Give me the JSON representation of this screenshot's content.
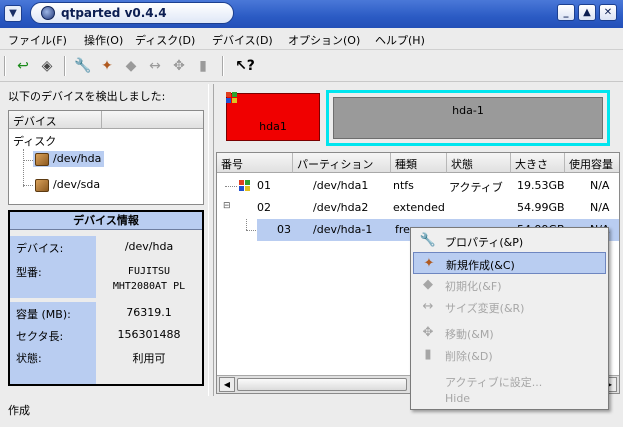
{
  "window": {
    "title": "qtparted v0.4.4"
  },
  "menu": [
    "ファイル(F)",
    "操作(O)",
    "ディスク(D)",
    "デバイス(D)",
    "オプション(O)",
    "ヘルプ(H)"
  ],
  "left": {
    "caption": "以下のデバイスを検出しました:",
    "tree_header": "デバイス",
    "tree_root": "ディスク",
    "devices": [
      "/dev/hda",
      "/dev/sda"
    ]
  },
  "info": {
    "title": "デバイス情報",
    "rows": [
      {
        "label": "デバイス:",
        "value": "/dev/hda"
      },
      {
        "label": "型番:",
        "value": "FUJITSU MHT2080AT PL"
      },
      {
        "label": "容量 (MB):",
        "value": "76319.1"
      },
      {
        "label": "セクタ長:",
        "value": "156301488"
      },
      {
        "label": "状態:",
        "value": "利用可"
      }
    ]
  },
  "status": "作成",
  "diskmap": {
    "primary_label": "hda1",
    "extended_label": "hda-1",
    "primary_color": "#f00000",
    "extended_border": "#00e5ee"
  },
  "table": {
    "headers": [
      "番号",
      "パーティション",
      "種類",
      "状態",
      "大きさ",
      "使用容量"
    ],
    "rows": [
      {
        "num": "01",
        "part": "/dev/hda1",
        "type": "ntfs",
        "state": "アクティブ",
        "size": "19.53GB",
        "used": "N/A"
      },
      {
        "num": "02",
        "part": "/dev/hda2",
        "type": "extended",
        "state": "",
        "size": "54.99GB",
        "used": "N/A"
      },
      {
        "num": "03",
        "part": "/dev/hda-1",
        "type": "free",
        "state": "",
        "size": "54.99GB",
        "used": "N/A"
      }
    ]
  },
  "context_menu": [
    {
      "label": "プロパティ(&P)",
      "enabled": true,
      "icon": "wrench-icon"
    },
    {
      "label": "新規作成(&C)",
      "enabled": true,
      "icon": "new-partition-icon",
      "highlighted": true
    },
    {
      "label": "初期化(&F)",
      "enabled": false,
      "icon": "eraser-icon"
    },
    {
      "label": "サイズ変更(&R)",
      "enabled": false,
      "icon": "resize-icon"
    },
    {
      "label": "移動(&M)",
      "enabled": false,
      "icon": "move-icon"
    },
    {
      "label": "削除(&D)",
      "enabled": false,
      "icon": "trash-icon"
    },
    {
      "label": "アクティブに設定...",
      "enabled": false,
      "icon": ""
    },
    {
      "label": "Hide",
      "enabled": false,
      "icon": ""
    }
  ],
  "colors": {
    "selection": "#b9cdf1",
    "titlebar": "#2b5bc4"
  }
}
